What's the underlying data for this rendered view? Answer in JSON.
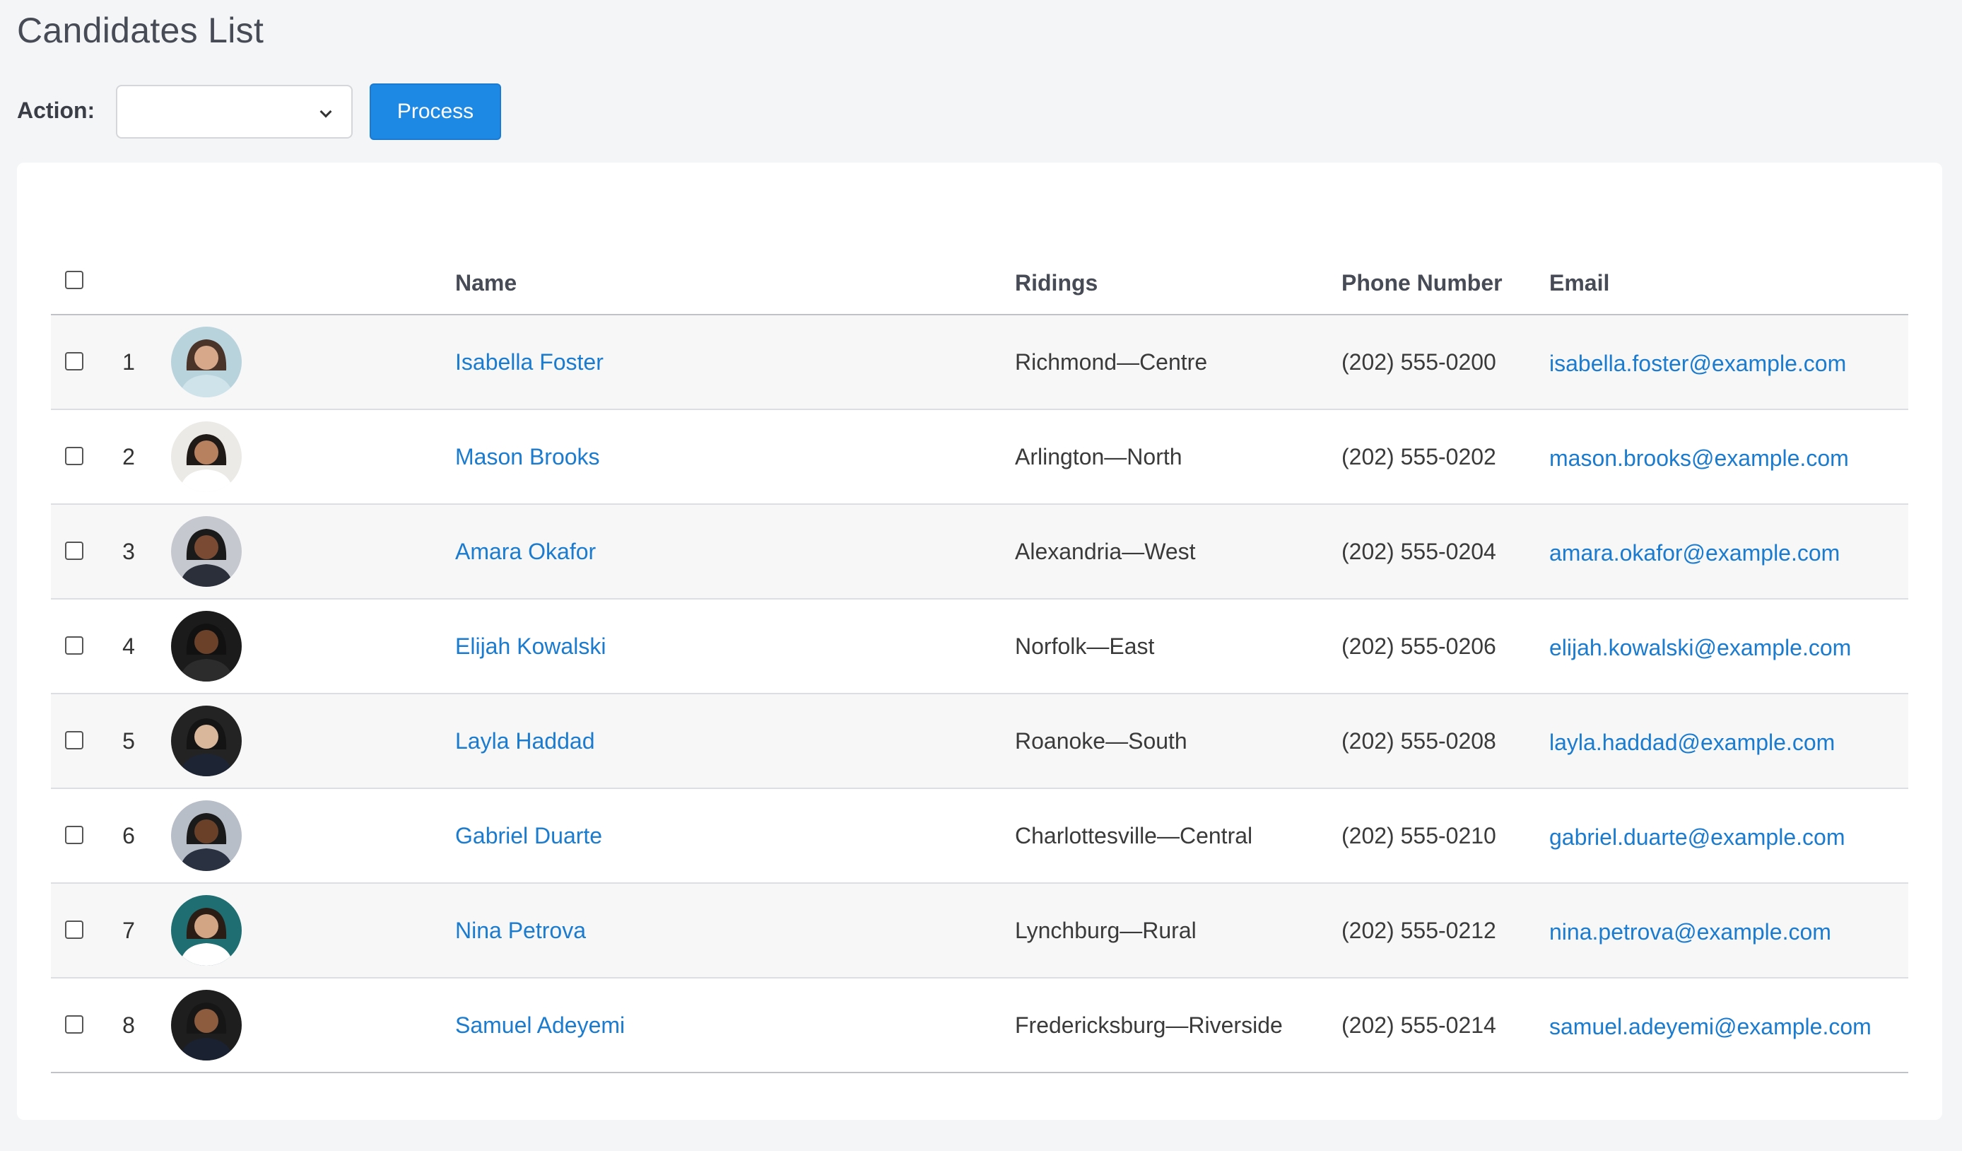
{
  "page": {
    "title": "Candidates List"
  },
  "toolbar": {
    "action_label": "Action:",
    "action_value": "",
    "process_label": "Process"
  },
  "table": {
    "headers": {
      "name": "Name",
      "ridings": "Ridings",
      "phone": "Phone Number",
      "email": "Email"
    },
    "rows": [
      {
        "num": "1",
        "name": "Isabella Foster",
        "riding": "Richmond—Centre",
        "phone": "(202) 555-0200",
        "email": "isabella.foster@example.com"
      },
      {
        "num": "2",
        "name": "Mason Brooks",
        "riding": "Arlington—North",
        "phone": "(202) 555-0202",
        "email": "mason.brooks@example.com"
      },
      {
        "num": "3",
        "name": "Amara Okafor",
        "riding": "Alexandria—West",
        "phone": "(202) 555-0204",
        "email": "amara.okafor@example.com"
      },
      {
        "num": "4",
        "name": "Elijah Kowalski",
        "riding": "Norfolk—East",
        "phone": "(202) 555-0206",
        "email": "elijah.kowalski@example.com"
      },
      {
        "num": "5",
        "name": "Layla Haddad",
        "riding": "Roanoke—South",
        "phone": "(202) 555-0208",
        "email": "layla.haddad@example.com"
      },
      {
        "num": "6",
        "name": "Gabriel Duarte",
        "riding": "Charlottesville—Central",
        "phone": "(202) 555-0210",
        "email": "gabriel.duarte@example.com"
      },
      {
        "num": "7",
        "name": "Nina Petrova",
        "riding": "Lynchburg—Rural",
        "phone": "(202) 555-0212",
        "email": "nina.petrova@example.com"
      },
      {
        "num": "8",
        "name": "Samuel Adeyemi",
        "riding": "Fredericksburg—Riverside",
        "phone": "(202) 555-0214",
        "email": "samuel.adeyemi@example.com"
      }
    ]
  },
  "colors": {
    "link": "#1a7bcf",
    "button": "#1e88e5",
    "background": "#f4f5f7"
  }
}
